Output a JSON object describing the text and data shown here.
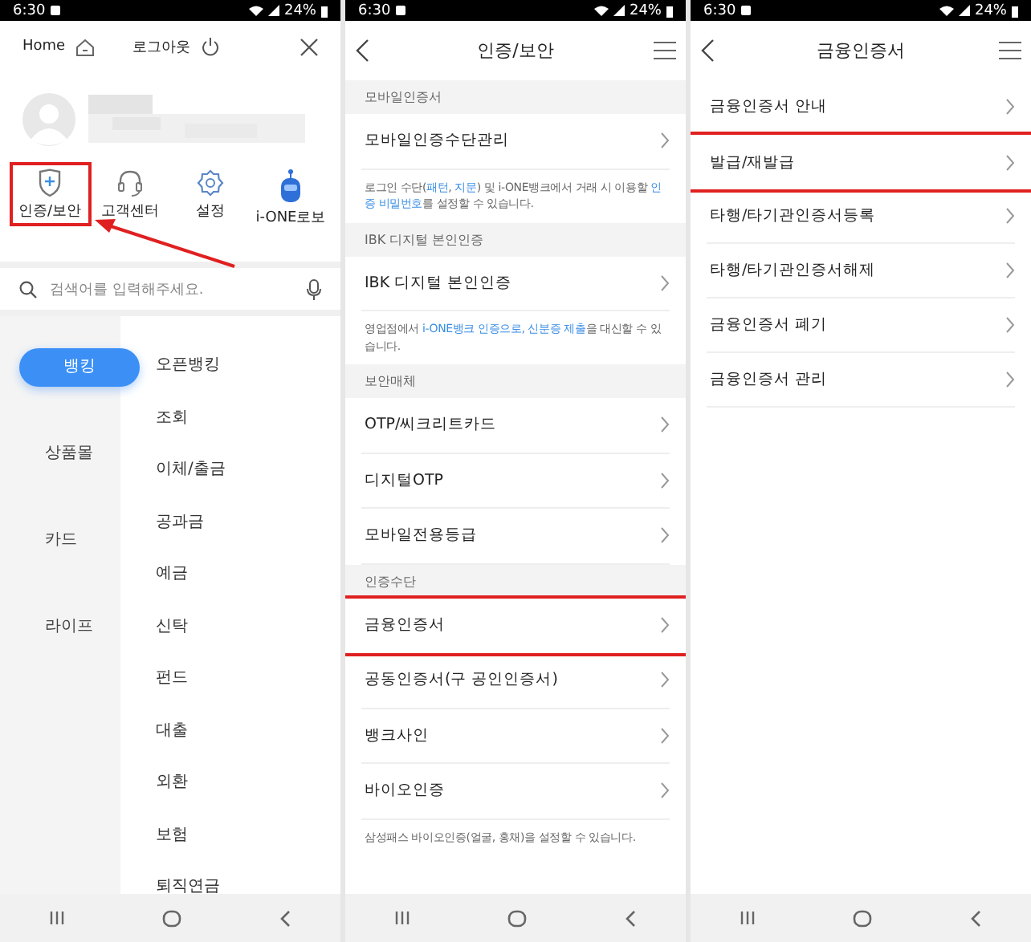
{
  "panels": [
    {
      "kind": "menu",
      "status_bar": {
        "time": "6:30",
        "battery": "24%"
      },
      "header": {
        "home_label": "Home",
        "logout_label": "로그아웃"
      },
      "shortcuts": [
        {
          "kind": "shield",
          "label": "인증/보안",
          "highlighted": true
        },
        {
          "kind": "headset",
          "label": "고객센터",
          "highlighted": false
        },
        {
          "kind": "gear",
          "label": "설정",
          "highlighted": false
        },
        {
          "kind": "robot",
          "label": "i-ONE로보",
          "highlighted": false
        }
      ],
      "search": {
        "placeholder": "검색어를 입력해주세요."
      },
      "categories": [
        {
          "label": "뱅킹",
          "selected": true
        },
        {
          "label": "상품몰",
          "selected": false
        },
        {
          "label": "카드",
          "selected": false
        },
        {
          "label": "라이프",
          "selected": false
        }
      ],
      "menu_items": [
        "오픈뱅킹",
        "조회",
        "이체/출금",
        "공과금",
        "예금",
        "신탁",
        "펀드",
        "대출",
        "외환",
        "보험",
        "퇴직연금"
      ]
    },
    {
      "kind": "list",
      "status_bar": {
        "time": "6:30",
        "battery": "24%"
      },
      "title": "인증/보안",
      "sections": [
        {
          "header": "모바일인증서",
          "rows": [
            {
              "label": "모바일인증수단관리",
              "highlighted": false
            }
          ],
          "note": [
            {
              "text": "로그인 수단(",
              "highlight": false
            },
            {
              "text": "패턴",
              "highlight": true
            },
            {
              "text": ", ",
              "highlight": false
            },
            {
              "text": "지문",
              "highlight": true
            },
            {
              "text": ") 및 i-ONE뱅크에서 거래 시 이용할 ",
              "highlight": false
            },
            {
              "text": "인증 비밀번호",
              "highlight": true
            },
            {
              "text": "를 설정할 수 있습니다.",
              "highlight": false
            }
          ]
        },
        {
          "header": "IBK 디지털 본인인증",
          "rows": [
            {
              "label": "IBK 디지털 본인인증",
              "highlighted": false
            }
          ],
          "note": [
            {
              "text": "영업점에서 ",
              "highlight": false
            },
            {
              "text": "i-ONE뱅크 인증으로, 신분증 제출",
              "highlight": true
            },
            {
              "text": "을 대신할 수 있습니다.",
              "highlight": false
            }
          ]
        },
        {
          "header": "보안매체",
          "rows": [
            {
              "label": "OTP/씨크리트카드",
              "highlighted": false
            },
            {
              "label": "디지털OTP",
              "highlighted": false
            },
            {
              "label": "모바일전용등급",
              "highlighted": false
            }
          ]
        },
        {
          "header": "인증수단",
          "rows": [
            {
              "label": "금융인증서",
              "highlighted": true
            },
            {
              "label": "공동인증서(구 공인인증서)",
              "highlighted": false
            },
            {
              "label": "뱅크사인",
              "highlighted": false
            },
            {
              "label": "바이오인증",
              "highlighted": false
            }
          ],
          "note": [
            {
              "text": "삼성패스 바이오인증(얼굴, 홍채)을 설정할 수 있습니다.",
              "highlight": false
            }
          ]
        }
      ]
    },
    {
      "kind": "list",
      "status_bar": {
        "time": "6:30",
        "battery": "24%"
      },
      "title": "금융인증서",
      "sections": [
        {
          "rows": [
            {
              "label": "금융인증서 안내",
              "highlighted": false
            },
            {
              "label": "발급/재발급",
              "highlighted": true
            },
            {
              "label": "타행/타기관인증서등록",
              "highlighted": false
            },
            {
              "label": "타행/타기관인증서해제",
              "highlighted": false
            },
            {
              "label": "금융인증서 폐기",
              "highlighted": false
            },
            {
              "label": "금융인증서 관리",
              "highlighted": false
            }
          ]
        }
      ]
    }
  ]
}
